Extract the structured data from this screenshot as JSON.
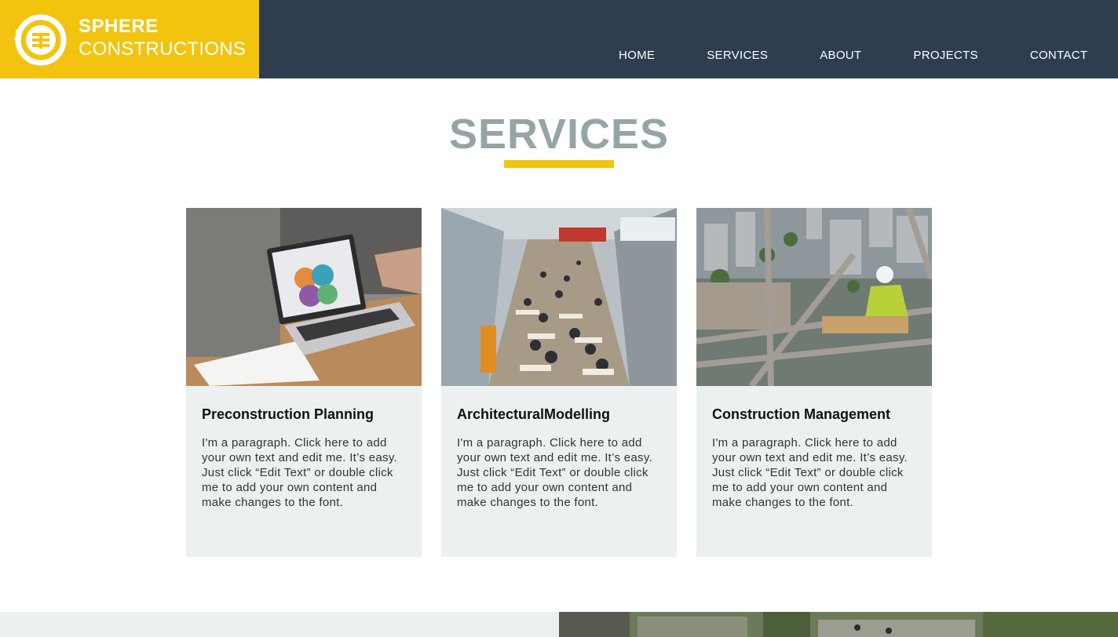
{
  "brand": {
    "line1": "SPHERE",
    "line2": "CONSTRUCTIONS"
  },
  "nav": [
    "HOME",
    "SERVICES",
    "ABOUT",
    "PROJECTS",
    "CONTACT"
  ],
  "section_title": "SERVICES",
  "services": [
    {
      "title": "Preconstruction Planning",
      "text": "I'm a paragraph. Click here to add your own text and edit me. It’s easy. Just click “Edit Text” or double click me to add your own content and make changes to the font."
    },
    {
      "title": "ArchitecturalModelling",
      "text": "I'm a paragraph. Click here to add your own text and edit me. It’s easy. Just click “Edit Text” or double click me to add your own content and make changes to the font."
    },
    {
      "title": "Construction Management",
      "text": "I'm a paragraph. Click here to add your own text and edit me. It’s easy. Just click “Edit Text” or double click me to add your own content and make changes to the font."
    }
  ],
  "colors": {
    "header": "#2e3d50",
    "accent": "#f2c40f",
    "title": "#95a5a6",
    "card_bg": "#ecf0f1"
  }
}
